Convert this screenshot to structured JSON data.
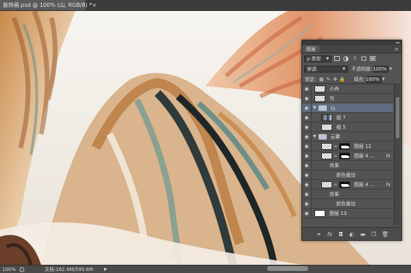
{
  "document_tab": {
    "title": "装饰画.psd @ 100% (山, RGB/8) *",
    "close": "×"
  },
  "status_bar": {
    "zoom": "100%",
    "doc_info": "文档:162.8M/599.6M",
    "arrow": "▶"
  },
  "layers_panel": {
    "title": "图层",
    "collapse_glyph": "◂◂",
    "menu_glyph": "≡",
    "filter": {
      "label": "类型",
      "icons": [
        "image-filter-icon",
        "adjustment-filter-icon",
        "type-filter-icon",
        "shape-filter-icon",
        "smart-object-filter-icon"
      ]
    },
    "blend_mode": "穿透",
    "opacity_label": "不透明度:",
    "opacity_value": "100%",
    "lock_label": "锁定:",
    "fill_label": "填充:",
    "fill_value": "100%",
    "layers": [
      {
        "name": "小舟",
        "kind": "layer",
        "thumb": "trans",
        "visible": true
      },
      {
        "name": "鸟",
        "kind": "layer",
        "thumb": "trans",
        "visible": true
      },
      {
        "name": "山",
        "kind": "group",
        "expanded": true,
        "selected": true,
        "visible": true
      },
      {
        "name": "组 7",
        "kind": "layer",
        "thumb": "photo",
        "indent": true,
        "visible": true
      },
      {
        "name": "组 5",
        "kind": "layer",
        "thumb": "trans",
        "indent": true,
        "visible": true
      },
      {
        "name": "云雾",
        "kind": "group",
        "expanded": true,
        "visible": true
      },
      {
        "name": "图层 12",
        "kind": "masked",
        "indent": true,
        "visible": true
      },
      {
        "name": "图层 4 ...",
        "kind": "masked",
        "indent": true,
        "fx": "fx",
        "visible": true
      },
      {
        "name": "效果",
        "kind": "effects",
        "visible": true
      },
      {
        "name": "颜色叠加",
        "kind": "effect",
        "visible": true
      },
      {
        "name": "图层 4 ...",
        "kind": "masked",
        "indent": true,
        "fx": "fx",
        "visible": true
      },
      {
        "name": "效果",
        "kind": "effects",
        "visible": true
      },
      {
        "name": "颜色叠加",
        "kind": "effect",
        "visible": true
      },
      {
        "name": "图层 13",
        "kind": "layer",
        "thumb": "white",
        "visible": true
      }
    ],
    "footer_icons": [
      "link-layers-icon",
      "fx-icon",
      "add-mask-icon",
      "adjustment-layer-icon",
      "new-group-icon",
      "new-layer-icon",
      "delete-layer-icon"
    ]
  }
}
